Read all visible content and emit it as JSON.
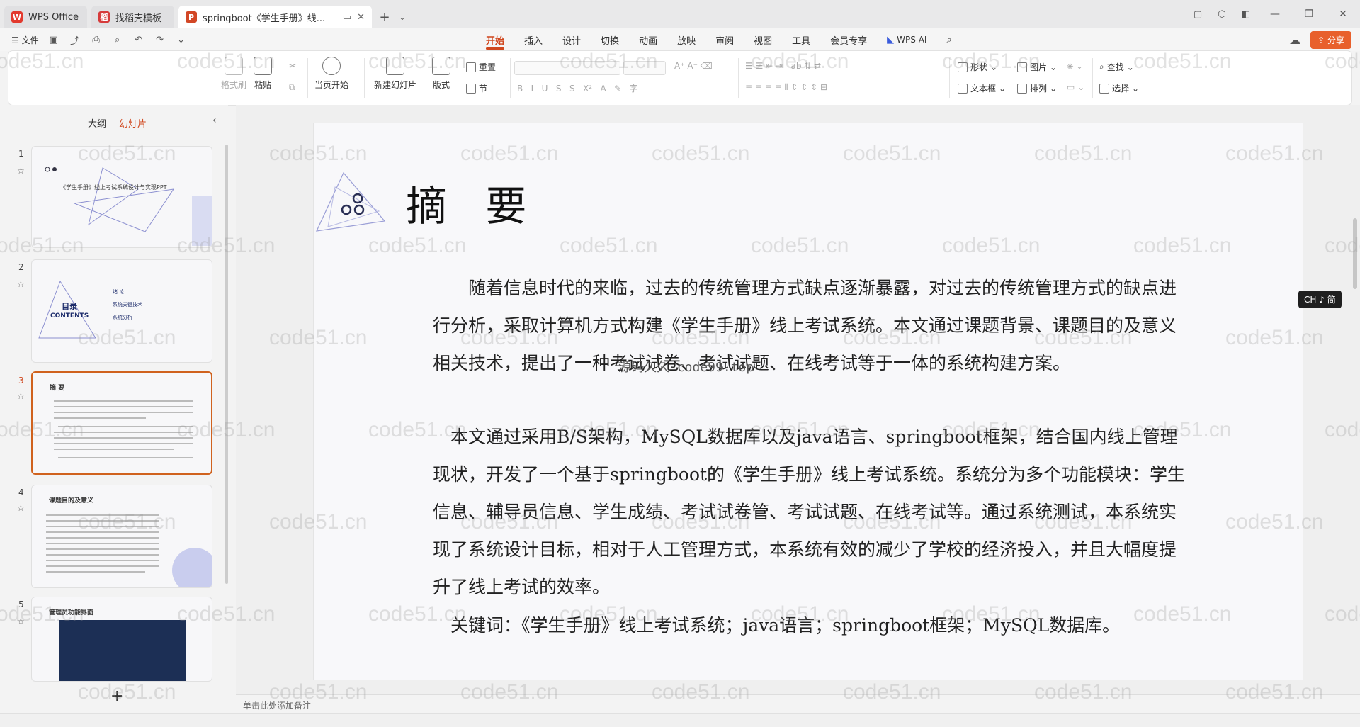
{
  "tabs": [
    {
      "label": "WPS Office",
      "icon": "wps-logo-icon",
      "color": "#e23a2e"
    },
    {
      "label": "找稻壳模板",
      "icon": "docer-logo-icon",
      "color": "#d63b3b"
    },
    {
      "label": "springboot《学生手册》线...",
      "icon": "ppt-file-icon",
      "color": "#d24726",
      "active": true
    }
  ],
  "menubar": {
    "file": "文件",
    "ribbon_tabs": [
      "开始",
      "插入",
      "设计",
      "切换",
      "动画",
      "放映",
      "审阅",
      "视图",
      "工具",
      "会员专享"
    ],
    "active_tab": "开始",
    "wps_ai": "WPS AI",
    "share": "分享"
  },
  "ribbon": {
    "format_painter": "格式刷",
    "paste": "粘贴",
    "start_from_current": "当页开始",
    "new_slide": "新建幻灯片",
    "layout": "版式",
    "reset": "重置",
    "section": "节",
    "shape": "形状",
    "picture": "图片",
    "find": "查找",
    "textbox": "文本框",
    "arrange": "排列",
    "select": "选择"
  },
  "leftpane": {
    "outline_tab": "大纲",
    "slides_tab": "幻灯片",
    "thumbnails": [
      {
        "num": "1",
        "text": "《学生手册》线上考试系统设计与实现PPT"
      },
      {
        "num": "2",
        "text_title": "目录",
        "text_sub": "CONTENTS",
        "items": [
          "绪 论",
          "系统关键技术",
          "系统分析"
        ]
      },
      {
        "num": "3",
        "text": "摘 要",
        "selected": true
      },
      {
        "num": "4",
        "text": "课题目的及意义"
      },
      {
        "num": "5",
        "text": "管理员功能界面"
      }
    ]
  },
  "slide": {
    "title": "摘 要",
    "paragraphs": [
      "　　随着信息时代的来临，过去的传统管理方式缺点逐渐暴露，对过去的传统管理方式的缺点进行分析，采取计算机方式构建《学生手册》线上考试系统。本文通过课题背景、课题目的及意义相关技术，提出了一种考试试卷、考试试题、在线考试等于一体的系统构建方案。",
      "　本文通过采用B/S架构，MySQL数据库以及java语言、springboot框架，结合国内线上管理现状，开发了一个基于springboot的《学生手册》线上考试系统。系统分为多个功能模块：学生信息、辅导员信息、学生成绩、考试试卷管、考试试题、在线考试等。通过系统测试，本系统实现了系统设计目标，相对于人工管理方式，本系统有效的减少了学校的经济投入，并且大幅度提升了线上考试的效率。",
      "　关键词：《学生手册》线上考试系统；java语言；springboot框架；MySQL数据库。"
    ],
    "overlay_text": "源码久久 code99.top"
  },
  "notes_placeholder": "单击此处添加备注",
  "ime": "CH ♪ 简",
  "watermark": "code51.cn"
}
